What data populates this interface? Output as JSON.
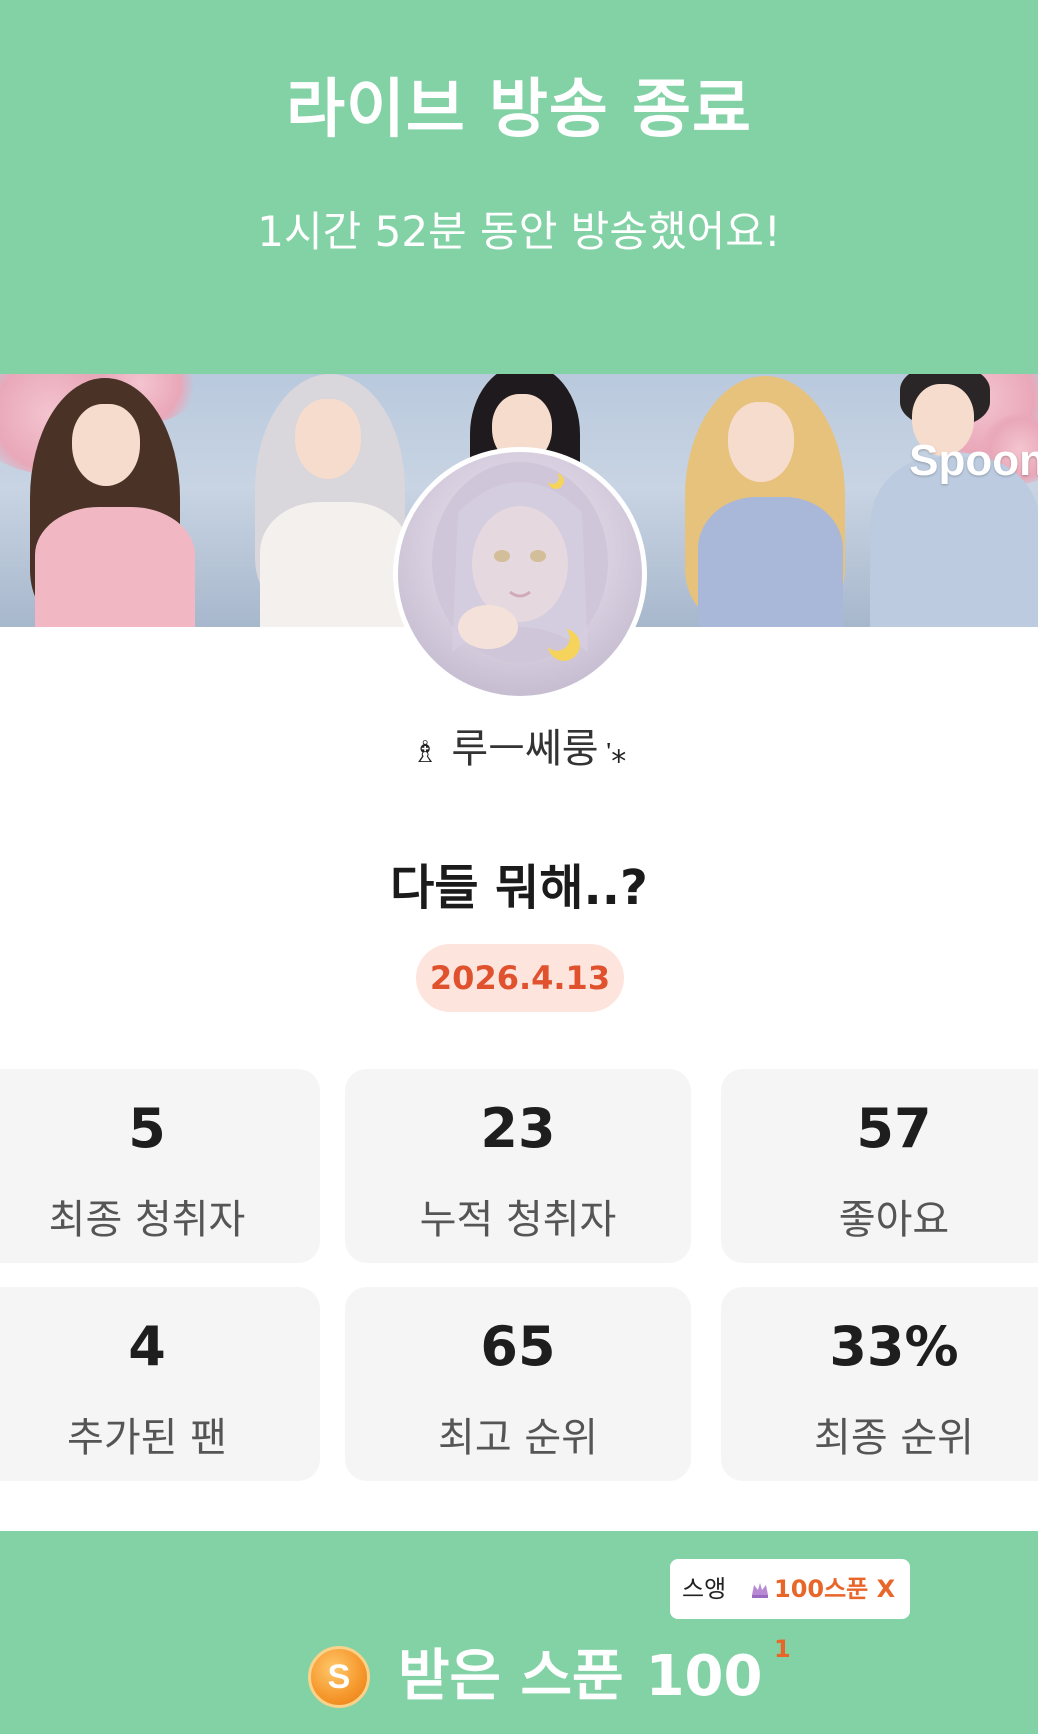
{
  "header": {
    "title": "라이브 방송 종료",
    "duration_text": "1시간 52분 동안 방송했어요!"
  },
  "banner": {
    "logo_text": "Spoon"
  },
  "profile": {
    "nickname_prefix": "♗",
    "nickname": "루ㅡ쎄룽",
    "nickname_suffix": "ᡃ⁎"
  },
  "live": {
    "title": "다들 뭐해..?",
    "date": "2026.4.13"
  },
  "stats": [
    {
      "value": "5",
      "label": "최종 청취자"
    },
    {
      "value": "23",
      "label": "누적 청취자"
    },
    {
      "value": "57",
      "label": "좋아요"
    },
    {
      "value": "4",
      "label": "추가된 팬"
    },
    {
      "value": "65",
      "label": "최고 순위"
    },
    {
      "value": "33%",
      "label": "최종 순위"
    }
  ],
  "footer": {
    "gift_sender": "스앵",
    "gift_icon": "crown-icon",
    "gift_text": "100스푼 X 1",
    "coin_letter": "S",
    "received_label": "받은 스푼",
    "received_amount": "100"
  },
  "colors": {
    "brand_green": "#83d2a6",
    "date_text": "#e0512d",
    "date_bg": "#fde4dc",
    "gift_text": "#e8662a",
    "coin": "#f5962a"
  }
}
